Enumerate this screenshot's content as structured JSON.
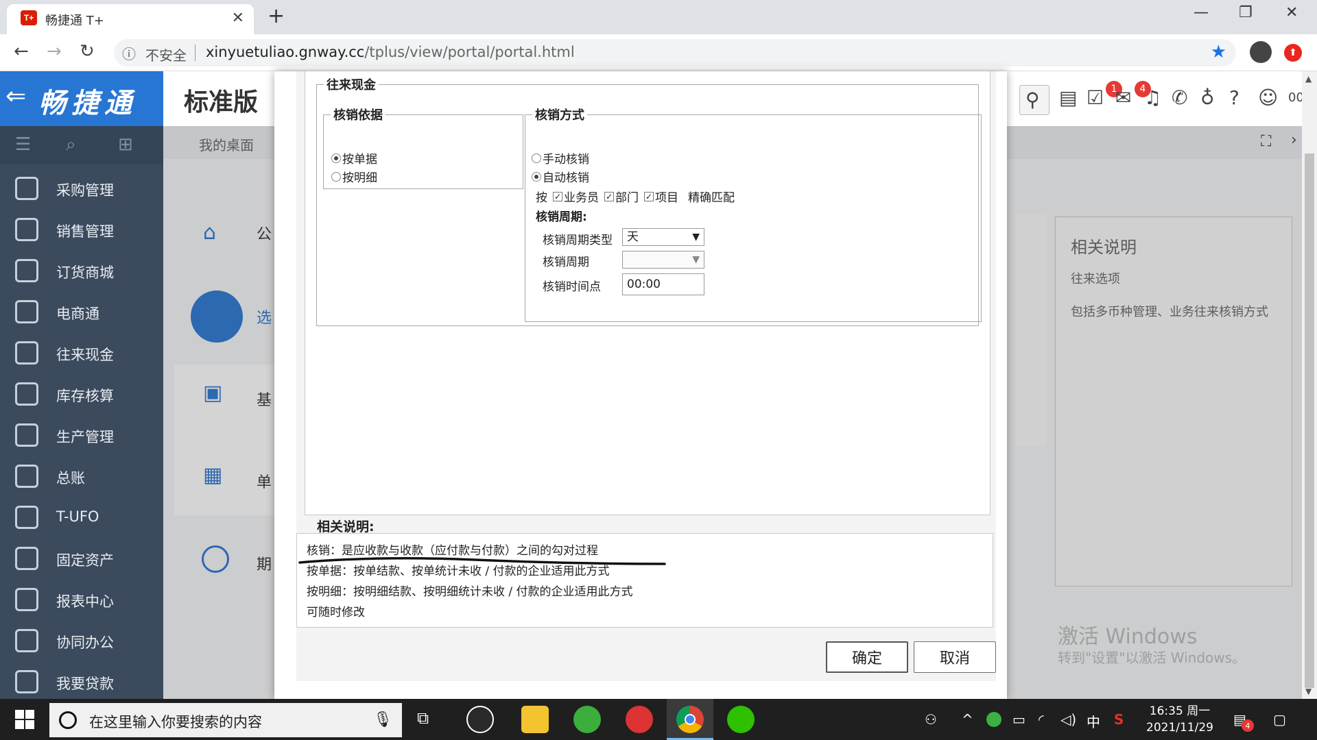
{
  "browser": {
    "tab_title": "畅捷通 T+",
    "tab_icon_text": "T+",
    "insecure_label": "不安全",
    "url_host": "xinyuetuliao.gnway.cc",
    "url_path": "/tplus/view/portal/portal.html"
  },
  "app": {
    "brand": "畅捷通",
    "edition": "标准版",
    "desk_tab": "我的桌面",
    "badges": {
      "notify1": "1",
      "notify2": "4"
    },
    "header_cut": "00",
    "sidebar": [
      {
        "label": "采购管理",
        "icon": "cart-icon"
      },
      {
        "label": "销售管理",
        "icon": "chart-bars-icon"
      },
      {
        "label": "订货商城",
        "icon": "store-icon"
      },
      {
        "label": "电商通",
        "icon": "ecommerce-icon"
      },
      {
        "label": "往来现金",
        "icon": "cash-icon"
      },
      {
        "label": "库存核算",
        "icon": "inventory-icon"
      },
      {
        "label": "生产管理",
        "icon": "production-icon"
      },
      {
        "label": "总账",
        "icon": "ledger-icon"
      },
      {
        "label": "T-UFO",
        "icon": "ufo-icon"
      },
      {
        "label": "固定资产",
        "icon": "assets-icon"
      },
      {
        "label": "报表中心",
        "icon": "report-icon"
      },
      {
        "label": "协同办公",
        "icon": "office-icon"
      },
      {
        "label": "我要贷款",
        "icon": "loan-icon"
      }
    ],
    "bg_items": [
      "公",
      "选",
      "基",
      "单",
      "期"
    ],
    "related": {
      "title": "相关说明",
      "line1": "往来选项",
      "line2": "包括多币种管理、业务往来核销方式"
    },
    "watermark": {
      "line1": "激活 Windows",
      "line2": "转到\"设置\"以激活 Windows。"
    }
  },
  "dialog": {
    "group_title": "往来现金",
    "basis": {
      "legend": "核销依据",
      "options": [
        {
          "label": "按单据",
          "checked": true
        },
        {
          "label": "按明细",
          "checked": false
        }
      ]
    },
    "method": {
      "legend": "核销方式",
      "options": [
        {
          "label": "手动核销",
          "checked": false
        },
        {
          "label": "自动核销",
          "checked": true
        }
      ],
      "match_prefix": "按",
      "match_items": [
        "业务员",
        "部门",
        "项目"
      ],
      "match_suffix": "精确匹配",
      "period_title": "核销周期:",
      "period_type_label": "核销周期类型",
      "period_type_value": "天",
      "period_label": "核销周期",
      "period_value": "",
      "time_label": "核销时间点",
      "time_value": "00:00"
    },
    "desc_title": "相关说明:",
    "desc_lines": [
      "核销：是应收款与收款（应付款与付款）之间的勾对过程",
      "按单据：按单结款、按单统计未收 / 付款的企业适用此方式",
      "按明细：按明细结款、按明细统计未收 / 付款的企业适用此方式",
      "可随时修改"
    ],
    "ok": "确定",
    "cancel": "取消"
  },
  "taskbar": {
    "search_placeholder": "在这里输入你要搜索的内容",
    "ime": "中",
    "time": "16:35 周一",
    "date": "2021/11/29",
    "notif_count": "4"
  }
}
